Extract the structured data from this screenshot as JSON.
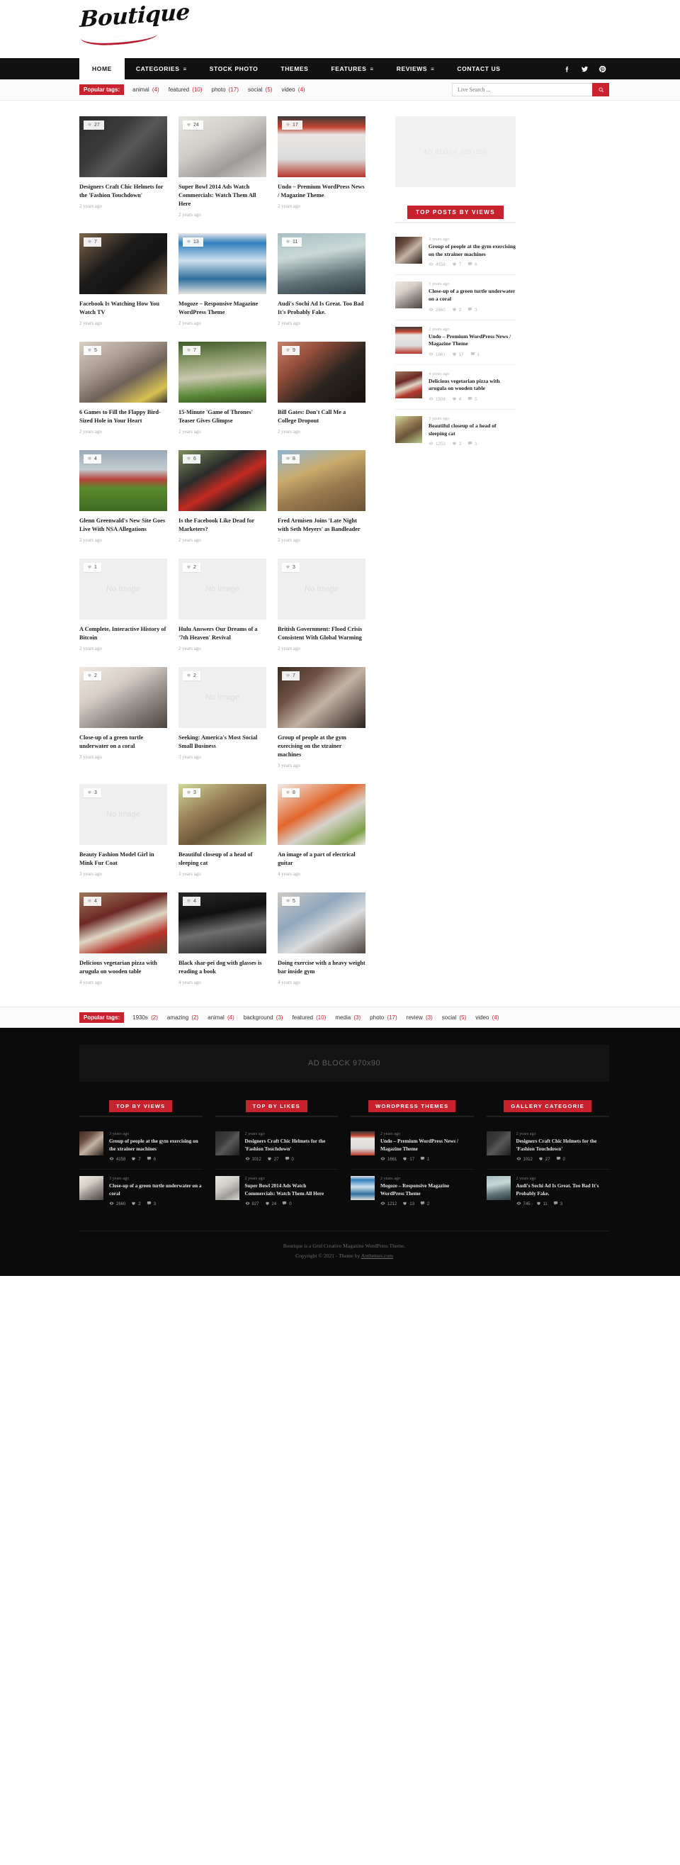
{
  "site": {
    "logo_text": "Boutique"
  },
  "nav": {
    "items": [
      {
        "label": "HOME",
        "active": true,
        "has_caret": false
      },
      {
        "label": "CATEGORIES",
        "active": false,
        "has_caret": true
      },
      {
        "label": "STOCK PHOTO",
        "active": false,
        "has_caret": false
      },
      {
        "label": "THEMES",
        "active": false,
        "has_caret": false
      },
      {
        "label": "FEATURES",
        "active": false,
        "has_caret": true
      },
      {
        "label": "REVIEWS",
        "active": false,
        "has_caret": true
      },
      {
        "label": "CONTACT US",
        "active": false,
        "has_caret": false
      }
    ],
    "social": [
      "facebook-icon",
      "twitter-icon",
      "pinterest-icon"
    ]
  },
  "topbar": {
    "tags_label": "Popular tags:",
    "tags": [
      {
        "name": "animal",
        "count": "(4)"
      },
      {
        "name": "featured",
        "count": "(10)"
      },
      {
        "name": "photo",
        "count": "(17)"
      },
      {
        "name": "social",
        "count": "(5)"
      },
      {
        "name": "video",
        "count": "(4)"
      }
    ],
    "search_placeholder": "Live Search ...",
    "search_value": ""
  },
  "bottombar": {
    "tags_label": "Popular tags:",
    "tags": [
      {
        "name": "1930s",
        "count": "(2)"
      },
      {
        "name": "amazing",
        "count": "(2)"
      },
      {
        "name": "animal",
        "count": "(4)"
      },
      {
        "name": "background",
        "count": "(3)"
      },
      {
        "name": "featured",
        "count": "(10)"
      },
      {
        "name": "media",
        "count": "(3)"
      },
      {
        "name": "photo",
        "count": "(17)"
      },
      {
        "name": "review",
        "count": "(3)"
      },
      {
        "name": "social",
        "count": "(5)"
      },
      {
        "name": "video",
        "count": "(4)"
      }
    ]
  },
  "main": {
    "cards": [
      {
        "likes": "27",
        "title": "Designers Craft Chic Helmets for the 'Fashion Touchdown'",
        "date": "2 years ago",
        "image": "helmet-on-dresser",
        "no_image": false
      },
      {
        "likes": "24",
        "title": "Super Bowl 2014 Ads Watch Commercials: Watch Them All Here",
        "date": "2 years ago",
        "image": "wristwatch-closeup",
        "no_image": false
      },
      {
        "likes": "17",
        "title": "Undo – Premium WordPress News / Magazine Theme",
        "date": "2 years ago",
        "image": "magazine-theme-screenshot",
        "no_image": false
      },
      {
        "likes": "7",
        "title": "Facebook Is Watching How You Watch TV",
        "date": "2 years ago",
        "image": "black-dog-on-wood",
        "no_image": false
      },
      {
        "likes": "13",
        "title": "Mogoze – Responsive Magazine WordPress Theme",
        "date": "2 years ago",
        "image": "blue-magazine-screenshot",
        "no_image": false
      },
      {
        "likes": "11",
        "title": "Audi's Sochi Ad Is Great. Too Bad It's Probably Fake.",
        "date": "2 years ago",
        "image": "foggy-railway",
        "no_image": false
      },
      {
        "likes": "5",
        "title": "6 Games to Fill the Flappy Bird-Sized Hole in Your Heart",
        "date": "2 years ago",
        "image": "teapot-on-table",
        "no_image": false
      },
      {
        "likes": "7",
        "title": "15-Minute 'Game of Thrones' Teaser Gives Glimpse",
        "date": "2 years ago",
        "image": "wooden-dock-grass",
        "no_image": false
      },
      {
        "likes": "9",
        "title": "Bill Gates: Don't Call Me a College Dropout",
        "date": "2 years ago",
        "image": "hands-on-grill",
        "no_image": false
      },
      {
        "likes": "4",
        "title": "Glenn Greenwald's New Site Goes Live With NSA Allegations",
        "date": "2 years ago",
        "image": "red-plane-on-grass",
        "no_image": false
      },
      {
        "likes": "6",
        "title": "Is the Facebook Like Dead for Marketers?",
        "date": "2 years ago",
        "image": "racehorse-red-mask",
        "no_image": false
      },
      {
        "likes": "8",
        "title": "Fred Armisen Joins 'Late Night with Seth Meyers' as Bandleader",
        "date": "2 years ago",
        "image": "yorkshire-terrier",
        "no_image": false
      },
      {
        "likes": "1",
        "title": "A Complete, Interactive History of Bitcoin",
        "date": "2 years ago",
        "image": "",
        "no_image": true,
        "no_image_text": "No Image"
      },
      {
        "likes": "2",
        "title": "Hulu Answers Our Dreams of a '7th Heaven' Revival",
        "date": "2 years ago",
        "image": "",
        "no_image": true,
        "no_image_text": "No Image"
      },
      {
        "likes": "3",
        "title": "British Government: Flood Crisis Consistent With Global Warming",
        "date": "2 years ago",
        "image": "",
        "no_image": true,
        "no_image_text": "No Image"
      },
      {
        "likes": "2",
        "title": "Close-up of a green turtle underwater on a coral",
        "date": "3 years ago",
        "image": "laptop-on-desk",
        "no_image": false
      },
      {
        "likes": "2",
        "title": "Seeking: America's Most Social Small Business",
        "date": "3 years ago",
        "image": "",
        "no_image": true,
        "no_image_text": "No Image"
      },
      {
        "likes": "7",
        "title": "Group of people at the gym exercising on the xtrainer machines",
        "date": "3 years ago",
        "image": "hands-typing-laptop",
        "no_image": false
      },
      {
        "likes": "3",
        "title": "Beauty Fashion Model Girl in Mink Fur Coat",
        "date": "3 years ago",
        "image": "",
        "no_image": true,
        "no_image_text": "No Image"
      },
      {
        "likes": "3",
        "title": "Beautiful closeup of a head of sleeping cat",
        "date": "3 years ago",
        "image": "brindle-dog-closeup",
        "no_image": false
      },
      {
        "likes": "8",
        "title": "An image of a part of electrical guitar",
        "date": "4 years ago",
        "image": "salad-bowl",
        "no_image": false
      },
      {
        "likes": "4",
        "title": "Delicious vegetarian pizza with arugula on wooden table",
        "date": "4 years ago",
        "image": "radio-on-red-chair",
        "no_image": false
      },
      {
        "likes": "4",
        "title": "Black shar-pei dog with glasses is reading a book",
        "date": "4 years ago",
        "image": "motorcycle-rider",
        "no_image": false
      },
      {
        "likes": "5",
        "title": "Doing exercise with a heavy weight bar inside gym",
        "date": "4 years ago",
        "image": "laptop-macbook-hands",
        "no_image": false
      }
    ]
  },
  "sidebar": {
    "ad_text": "AD BLOCK 300x250",
    "widget_title": "TOP POSTS BY VIEWS",
    "posts": [
      {
        "date": "3 years ago",
        "title": "Group of people at the gym exercising on the xtrainer machines",
        "views": "4158",
        "likes": "7",
        "comments": "6",
        "image": "hands-typing-laptop"
      },
      {
        "date": "3 years ago",
        "title": "Close-up of a green turtle underwater on a coral",
        "views": "2660",
        "likes": "2",
        "comments": "3",
        "image": "laptop-on-desk"
      },
      {
        "date": "2 years ago",
        "title": "Undo – Premium WordPress News / Magazine Theme",
        "views": "1661",
        "likes": "17",
        "comments": "1",
        "image": "magazine-theme-screenshot"
      },
      {
        "date": "4 years ago",
        "title": "Delicious vegetarian pizza with arugula on wooden table",
        "views": "1508",
        "likes": "4",
        "comments": "5",
        "image": "radio-on-red-chair"
      },
      {
        "date": "3 years ago",
        "title": "Beautiful closeup of a head of sleeping cat",
        "views": "1253",
        "likes": "3",
        "comments": "1",
        "image": "brindle-dog-closeup"
      }
    ]
  },
  "footer": {
    "ad_text": "AD BLOCK 970x90",
    "columns": [
      {
        "title": "TOP BY VIEWS",
        "items": [
          {
            "date": "3 years ago",
            "title": "Group of people at the gym exercising on the xtrainer machines",
            "views": "4158",
            "likes": "7",
            "comments": "6",
            "image": "hands-typing-laptop"
          },
          {
            "date": "3 years ago",
            "title": "Close-up of a green turtle underwater on a coral",
            "views": "2660",
            "likes": "2",
            "comments": "3",
            "image": "laptop-on-desk"
          }
        ]
      },
      {
        "title": "TOP BY LIKES",
        "items": [
          {
            "date": "2 years ago",
            "title": "Designers Craft Chic Helmets for the 'Fashion Touchdown'",
            "views": "1012",
            "likes": "27",
            "comments": "0",
            "image": "helmet-on-dresser"
          },
          {
            "date": "2 years ago",
            "title": "Super Bowl 2014 Ads Watch Commercials: Watch Them All Here",
            "views": "827",
            "likes": "24",
            "comments": "0",
            "image": "wristwatch-closeup"
          }
        ]
      },
      {
        "title": "WORDPRESS THEMES",
        "items": [
          {
            "date": "2 years ago",
            "title": "Undo – Premium WordPress News / Magazine Theme",
            "views": "1661",
            "likes": "17",
            "comments": "1",
            "image": "magazine-theme-screenshot"
          },
          {
            "date": "2 years ago",
            "title": "Mogoze – Responsive Magazine WordPress Theme",
            "views": "1212",
            "likes": "13",
            "comments": "2",
            "image": "blue-magazine-screenshot"
          }
        ]
      },
      {
        "title": "GALLERY CATEGORIE",
        "items": [
          {
            "date": "2 years ago",
            "title": "Designers Craft Chic Helmets for the 'Fashion Touchdown'",
            "views": "1012",
            "likes": "27",
            "comments": "0",
            "image": "helmet-on-dresser"
          },
          {
            "date": "2 years ago",
            "title": "Audi's Sochi Ad Is Great. Too Bad It's Probably Fake.",
            "views": "745",
            "likes": "11",
            "comments": "3",
            "image": "foggy-railway"
          }
        ]
      }
    ],
    "copyright_line1": "Boutique is a Grid Creative Magazine WordPress Theme.",
    "copyright_line2_prefix": "Copyright © 2021 - Theme by ",
    "copyright_link": "Anthemes.com"
  },
  "colors": {
    "accent": "#c9222f",
    "nav_bg": "#111111",
    "footer_bg": "#0b0b0b"
  }
}
